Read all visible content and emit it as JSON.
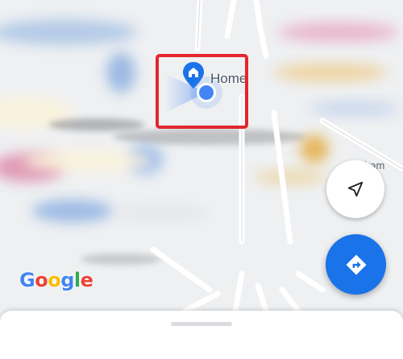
{
  "map": {
    "place_label": "Home",
    "road_label": "iram",
    "logo_letters": [
      {
        "char": "G",
        "color": "#4285F4"
      },
      {
        "char": "o",
        "color": "#EA4335"
      },
      {
        "char": "o",
        "color": "#FBBC05"
      },
      {
        "char": "g",
        "color": "#4285F4"
      },
      {
        "char": "l",
        "color": "#34A853"
      },
      {
        "char": "e",
        "color": "#EA4335"
      }
    ]
  },
  "icons": {
    "home_pin": "home-icon",
    "my_location": "location-dot-icon",
    "compass": "navigation-arrow-icon",
    "directions": "directions-icon"
  },
  "colors": {
    "accent": "#1a73e8",
    "highlight": "#e3262b"
  }
}
